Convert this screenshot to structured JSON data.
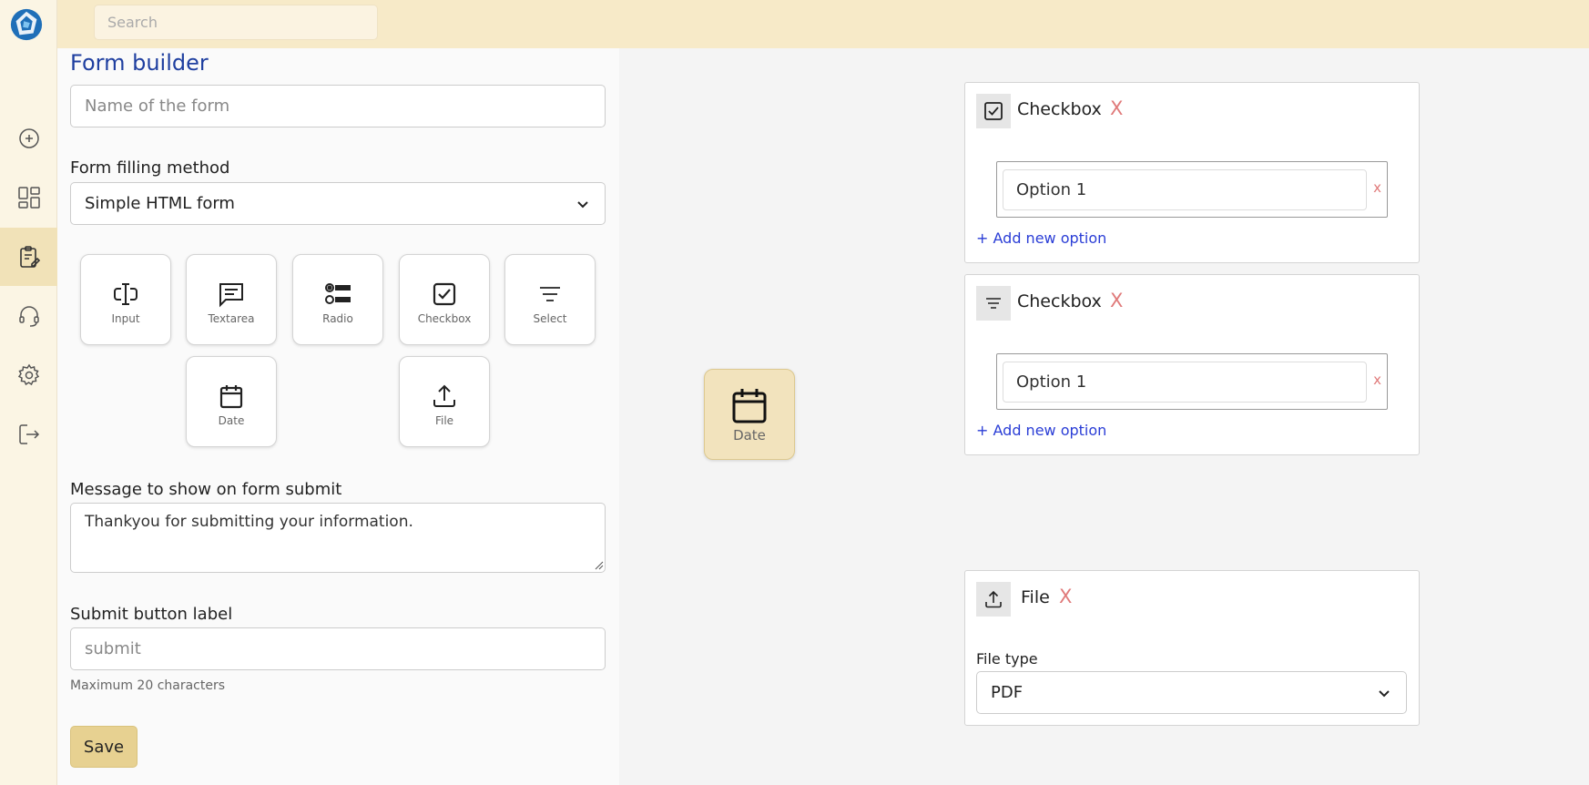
{
  "search": {
    "placeholder": "Search"
  },
  "sidebar": {
    "items": [
      {
        "name": "add",
        "icon": "plus-circle-icon"
      },
      {
        "name": "dashboard",
        "icon": "dashboard-icon"
      },
      {
        "name": "forms",
        "icon": "clipboard-edit-icon",
        "active": true
      },
      {
        "name": "support",
        "icon": "headset-icon"
      },
      {
        "name": "settings",
        "icon": "gear-icon"
      },
      {
        "name": "logout",
        "icon": "logout-icon"
      }
    ]
  },
  "builder": {
    "title": "Form builder",
    "name_placeholder": "Name of the form",
    "method_label": "Form filling method",
    "method_value": "Simple HTML form",
    "tiles": [
      {
        "label": "Input",
        "icon": "text-cursor-icon"
      },
      {
        "label": "Textarea",
        "icon": "message-square-icon"
      },
      {
        "label": "Radio",
        "icon": "radio-list-icon"
      },
      {
        "label": "Checkbox",
        "icon": "checkbox-icon"
      },
      {
        "label": "Select",
        "icon": "select-lines-icon"
      },
      {
        "label": "Date",
        "icon": "calendar-icon"
      },
      {
        "label": "File",
        "icon": "upload-icon"
      }
    ],
    "message_label": "Message to show on form submit",
    "message_value": "Thankyou for submitting your information.",
    "submit_label": "Submit button label",
    "submit_placeholder": "submit",
    "submit_hint": "Maximum 20 characters",
    "save_label": "Save"
  },
  "canvas": {
    "dragging": {
      "label": "Date",
      "icon": "calendar-icon"
    },
    "cards": [
      {
        "title": "Checkbox",
        "icon": "checkbox-icon",
        "remove": "X",
        "option": "Option 1",
        "option_remove": "x",
        "add_option": "+ Add new option"
      },
      {
        "title": "Checkbox",
        "icon": "select-lines-icon",
        "remove": "X",
        "option": "Option 1",
        "option_remove": "x",
        "add_option": "+ Add new option"
      },
      {
        "title": "File",
        "icon": "upload-icon",
        "remove": "X",
        "file_type_label": "File type",
        "file_type_value": "PDF"
      }
    ]
  },
  "colors": {
    "topbar": "#f7eac8",
    "accent": "#e7d191",
    "title": "#1f3fa0",
    "link": "#2a3dd6",
    "remove": "#e07a7a"
  }
}
